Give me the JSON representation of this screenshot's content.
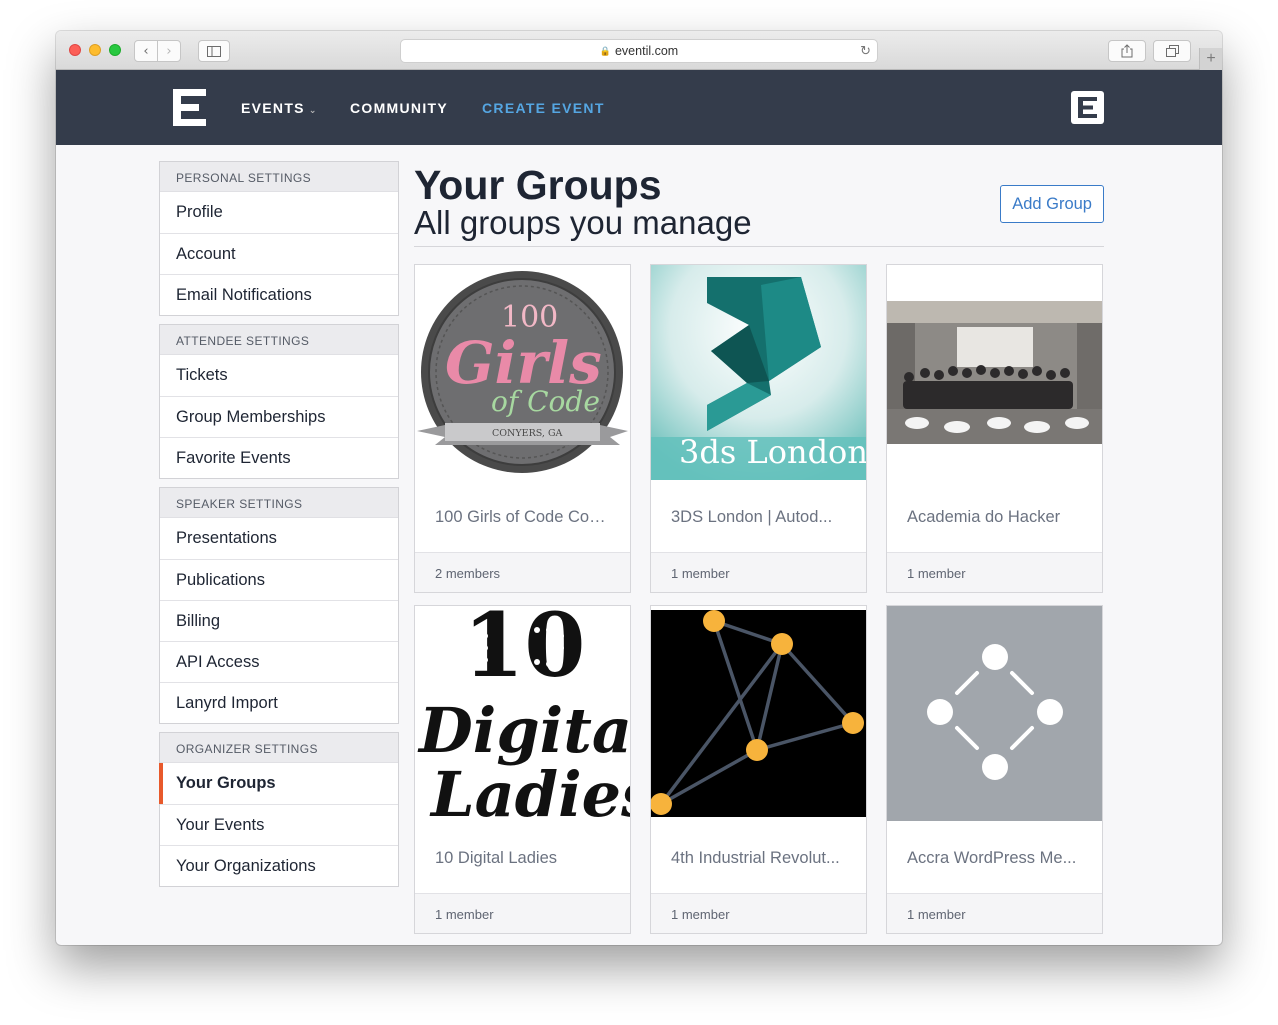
{
  "browser": {
    "url": "eventil.com"
  },
  "nav": {
    "events_label": "EVENTS",
    "community_label": "COMMUNITY",
    "create_event_label": "CREATE EVENT"
  },
  "sidebar": {
    "groups": [
      {
        "header": "PERSONAL SETTINGS",
        "items": [
          "Profile",
          "Account",
          "Email Notifications"
        ]
      },
      {
        "header": "ATTENDEE SETTINGS",
        "items": [
          "Tickets",
          "Group Memberships",
          "Favorite Events"
        ]
      },
      {
        "header": "SPEAKER SETTINGS",
        "items": [
          "Presentations",
          "Publications",
          "Billing",
          "API Access",
          "Lanyrd Import"
        ]
      },
      {
        "header": "ORGANIZER SETTINGS",
        "items": [
          "Your Groups",
          "Your Events",
          "Your Organizations"
        ],
        "active": "Your Groups"
      }
    ]
  },
  "main": {
    "title": "Your Groups",
    "subtitle": "All groups you manage",
    "add_group_label": "Add Group",
    "cards": [
      {
        "name": "100 Girls of Code Con...",
        "members": "2 members",
        "image_text": [
          "100",
          "Girls",
          "of Code",
          "CONYERS, GA"
        ]
      },
      {
        "name": "3DS London | Autod...",
        "members": "1 member",
        "image_text": [
          "3ds London"
        ]
      },
      {
        "name": "Academia do Hacker",
        "members": "1 member"
      },
      {
        "name": "10 Digital Ladies",
        "members": "1 member",
        "image_text": [
          "10",
          "Digital",
          "Ladies"
        ]
      },
      {
        "name": "4th Industrial Revolut...",
        "members": "1 member"
      },
      {
        "name": "Accra WordPress Me...",
        "members": "1 member"
      }
    ]
  }
}
